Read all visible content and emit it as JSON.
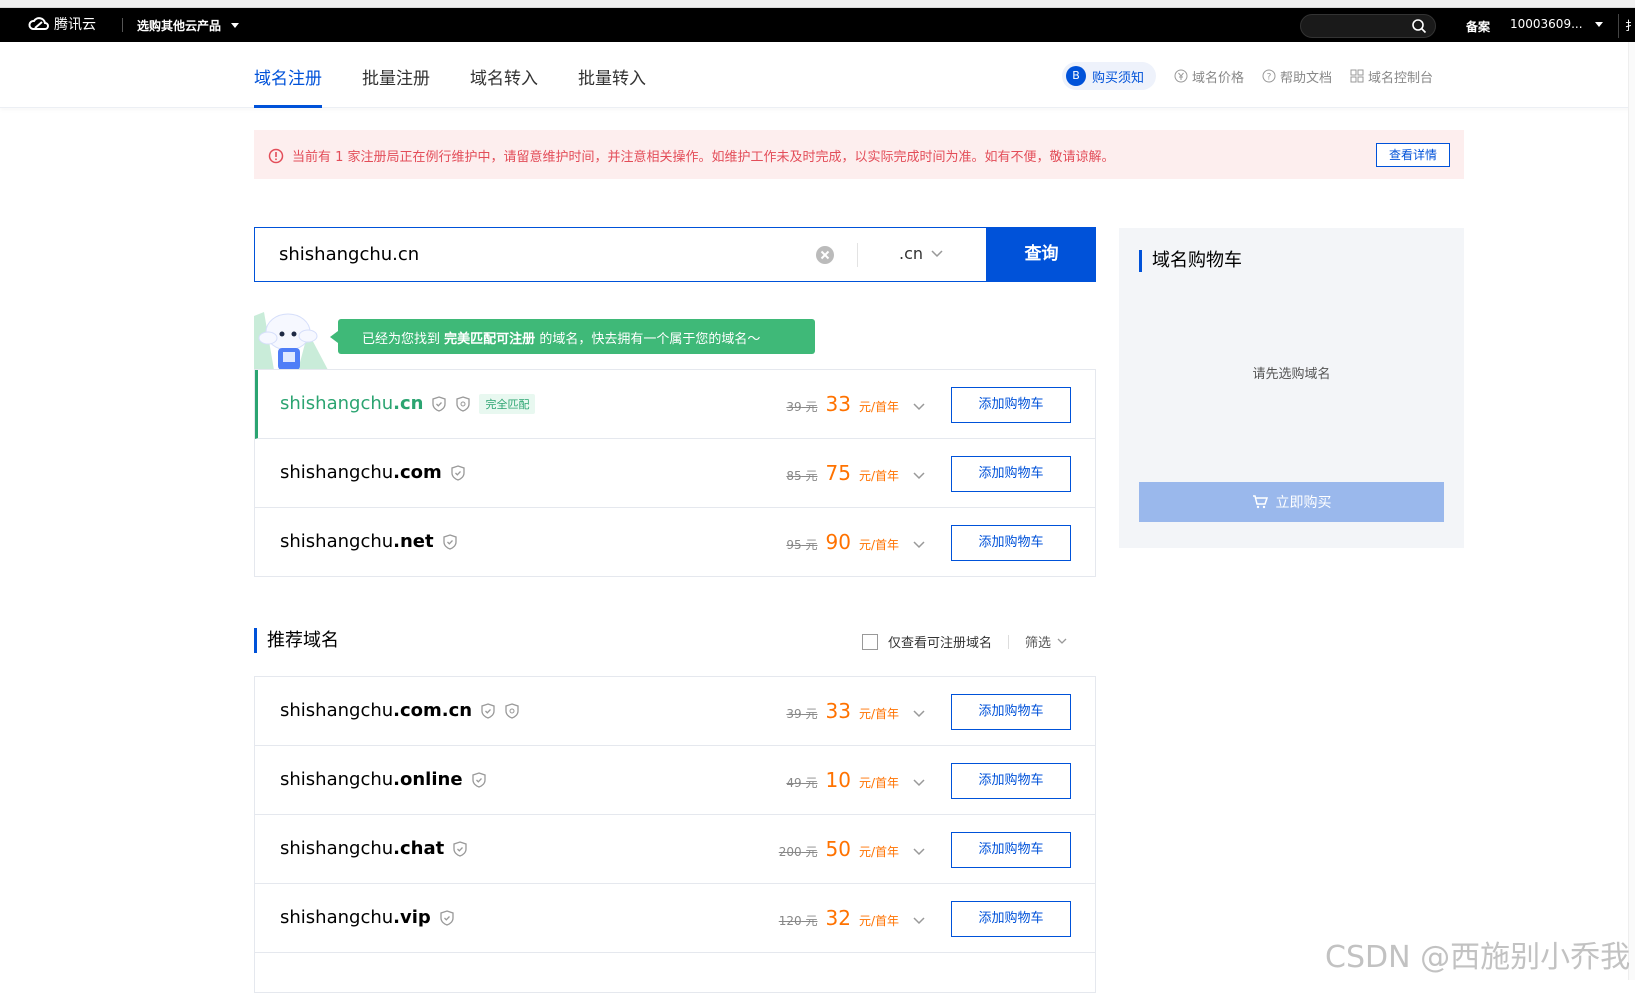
{
  "topbar": {
    "brand": "腾讯云",
    "products": "选购其他云产品",
    "search_placeholder": "",
    "beian": "备案",
    "account": "10003609..."
  },
  "nav": {
    "tabs": [
      {
        "label": "域名注册",
        "active": true
      },
      {
        "label": "批量注册",
        "active": false
      },
      {
        "label": "域名转入",
        "active": false
      },
      {
        "label": "批量转入",
        "active": false
      }
    ],
    "links": {
      "notice": "购买须知",
      "price": "域名价格",
      "help": "帮助文档",
      "console": "域名控制台"
    }
  },
  "notice": {
    "text": "当前有 1 家注册局正在例行维护中，请留意维护时间，并注意相关操作。如维护工作未及时完成，以实际完成时间为准。如有不便，敬请谅解。",
    "button": "查看详情"
  },
  "search": {
    "value": "shishangchu.cn",
    "suffix": ".cn",
    "button": "查询"
  },
  "match_banner": {
    "prefix": "已经为您找到",
    "highlight": "完美匹配可注册",
    "suffix": "的域名，快去拥有一个属于您的域名～"
  },
  "results": [
    {
      "base": "shishangchu",
      "tld": ".cn",
      "orig": "39",
      "now": "33",
      "tag": "完全匹配",
      "add": "添加购物车"
    },
    {
      "base": "shishangchu",
      "tld": ".com",
      "orig": "85",
      "now": "75",
      "add": "添加购物车"
    },
    {
      "base": "shishangchu",
      "tld": ".net",
      "orig": "95",
      "now": "90",
      "add": "添加购物车"
    }
  ],
  "price_units": {
    "orig": "元",
    "now": "元/首年"
  },
  "recommend": {
    "title": "推荐域名",
    "only_available": "仅查看可注册域名",
    "filter": "筛选",
    "items": [
      {
        "base": "shishangchu",
        "tld": ".com.cn",
        "orig": "39",
        "now": "33",
        "add": "添加购物车"
      },
      {
        "base": "shishangchu",
        "tld": ".online",
        "orig": "49",
        "now": "10",
        "add": "添加购物车"
      },
      {
        "base": "shishangchu",
        "tld": ".chat",
        "orig": "200",
        "now": "50",
        "add": "添加购物车"
      },
      {
        "base": "shishangchu",
        "tld": ".vip",
        "orig": "120",
        "now": "32",
        "add": "添加购物车"
      }
    ]
  },
  "cart": {
    "title": "域名购物车",
    "empty": "请先选购域名",
    "buy": "立即购买"
  },
  "watermark": "CSDN @西施别小乔我",
  "colors": {
    "brand": "#0052d9",
    "price": "#ff7200",
    "success": "#2ba471",
    "alert": "#e34d59"
  }
}
